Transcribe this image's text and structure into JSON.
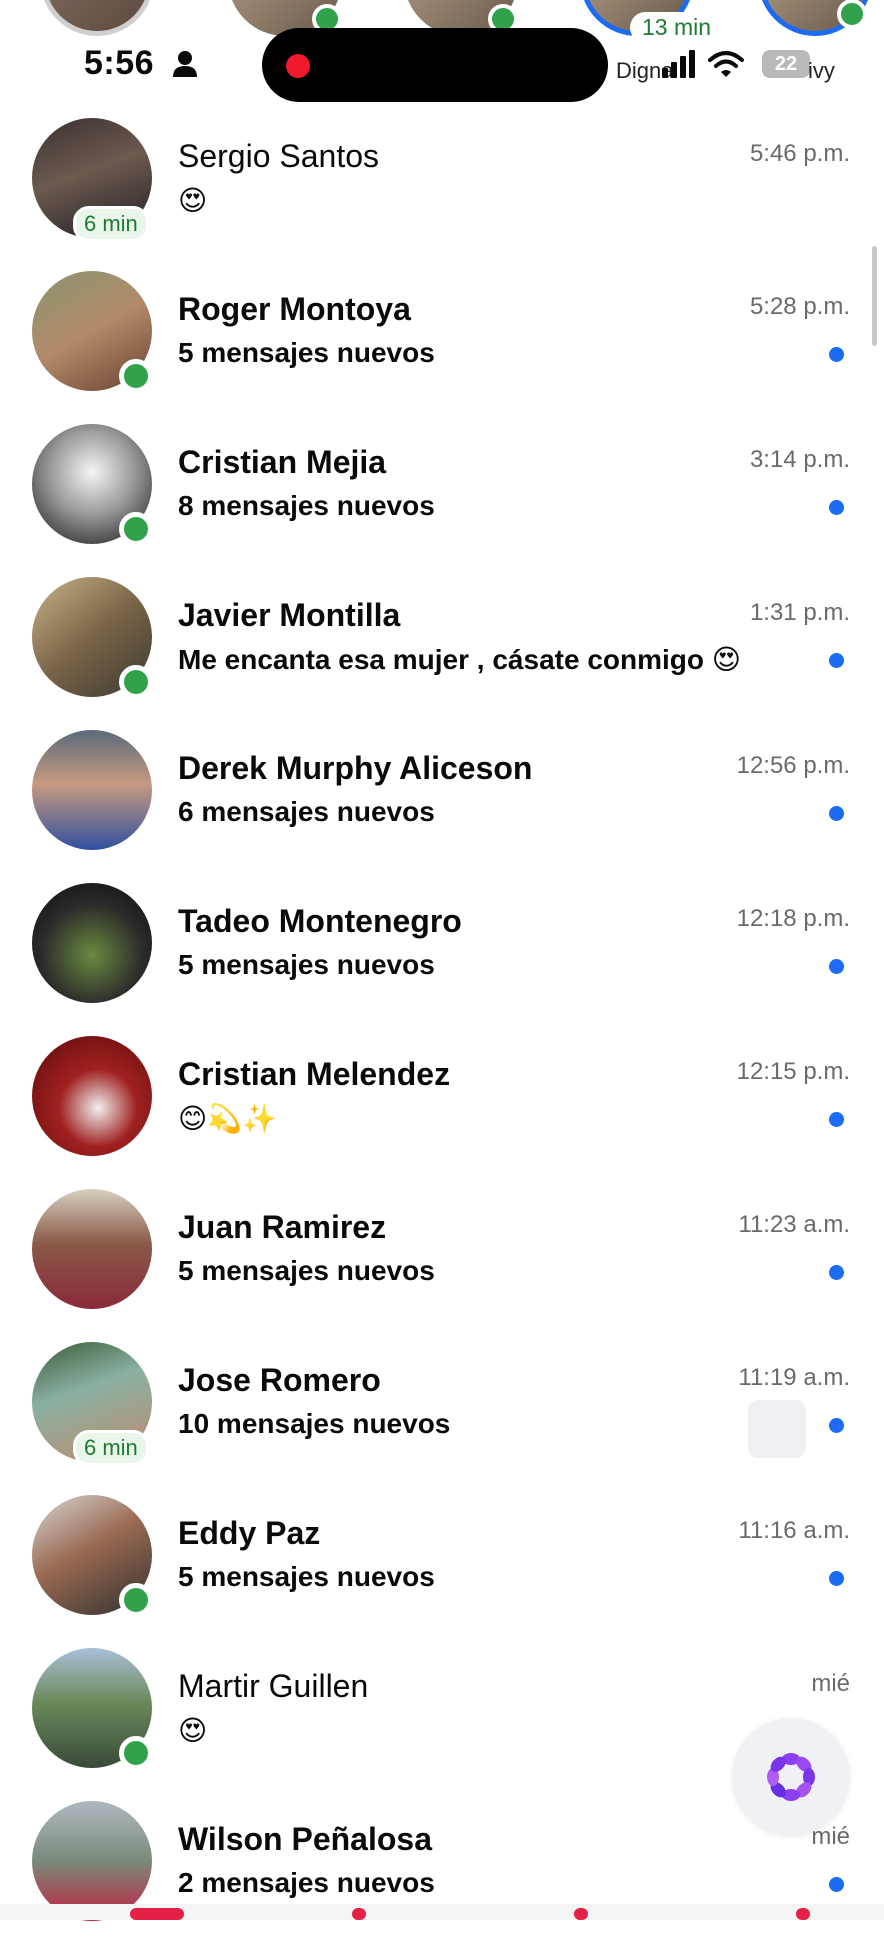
{
  "status_bar": {
    "time": "5:56",
    "carrier_left": "Digna",
    "carrier_right": "ivy",
    "battery": "22",
    "icons": [
      "person-icon",
      "signal-icon",
      "wifi-icon",
      "battery-icon"
    ]
  },
  "stories": {
    "badge": "13 min"
  },
  "conversations": [
    {
      "name": "Sergio Santos",
      "preview": "😍",
      "time": "5:46 p.m.",
      "unread": false,
      "badge": "6 min",
      "online": false
    },
    {
      "name": "Roger Montoya",
      "preview": "5 mensajes nuevos",
      "time": "5:28 p.m.",
      "unread": true,
      "online": true
    },
    {
      "name": "Cristian Mejia",
      "preview": "8 mensajes nuevos",
      "time": "3:14 p.m.",
      "unread": true,
      "online": true
    },
    {
      "name": "Javier Montilla",
      "preview": "Me encanta esa mujer , cásate conmigo 😍",
      "time": "1:31 p.m.",
      "unread": true,
      "online": true
    },
    {
      "name": "Derek Murphy Aliceson",
      "preview": "6 mensajes nuevos",
      "time": "12:56 p.m.",
      "unread": true,
      "online": false
    },
    {
      "name": "Tadeo Montenegro",
      "preview": "5 mensajes nuevos",
      "time": "12:18 p.m.",
      "unread": true,
      "online": false
    },
    {
      "name": "Cristian Melendez",
      "preview": "😊💫✨",
      "time": "12:15 p.m.",
      "unread": true,
      "online": false
    },
    {
      "name": "Juan Ramirez",
      "preview": "5 mensajes nuevos",
      "time": "11:23 a.m.",
      "unread": true,
      "online": false
    },
    {
      "name": "Jose Romero",
      "preview": "10 mensajes nuevos",
      "time": "11:19 a.m.",
      "unread": true,
      "badge": "6 min",
      "online": false
    },
    {
      "name": "Eddy Paz",
      "preview": "5 mensajes nuevos",
      "time": "11:16 a.m.",
      "unread": true,
      "online": true
    },
    {
      "name": "Martir Guillen",
      "preview": "😍",
      "time": "mié",
      "unread": false,
      "online": true
    },
    {
      "name": "Wilson Peñalosa",
      "preview": "2 mensajes nuevos",
      "time": "mié",
      "unread": true,
      "online": false
    }
  ],
  "colors": {
    "accent": "#1b6cf2",
    "online": "#31a24c",
    "badge_text": "#1e7b34",
    "fab_icon": "#8a3ff0"
  }
}
